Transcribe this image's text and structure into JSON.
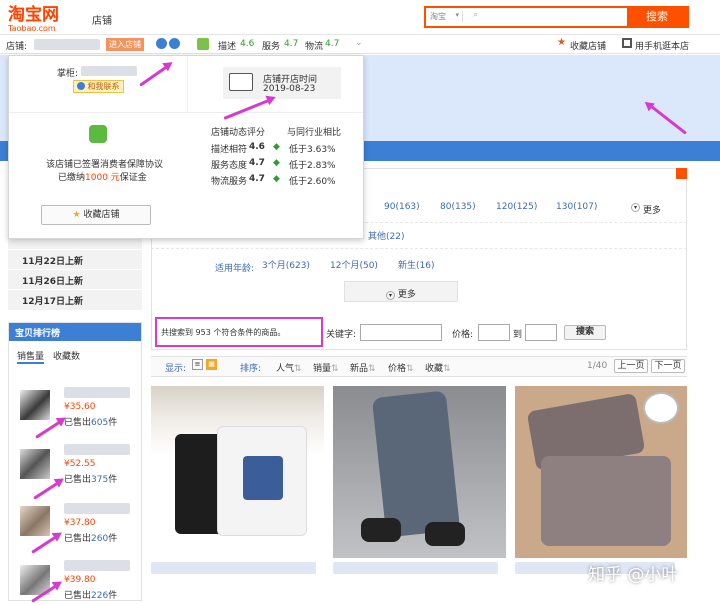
{
  "header": {
    "logo_cn": "淘宝网",
    "logo_en": "Taobao.com",
    "nav_label": "店铺",
    "search_scope": "淘宝",
    "search_button": "搜索"
  },
  "shopbar": {
    "shop_label": "店铺:",
    "enter_shop": "进入店铺",
    "desc_label": "描述",
    "desc_score": "4.6",
    "service_label": "服务",
    "service_score": "4.7",
    "logistics_label": "物流",
    "logistics_score": "4.7",
    "favorite": "收藏店铺",
    "mobile": "用手机逛本店"
  },
  "popup": {
    "keeper_label": "掌柜:",
    "contact": "和我联系",
    "open_time_label": "店铺开店时间",
    "open_time": "2019-08-23",
    "dynamic_label": "店铺动态评分",
    "compare_label": "与同行业相比",
    "ratings": [
      {
        "label": "描述相符",
        "score": "4.6",
        "compare": "低于3.63%"
      },
      {
        "label": "服务态度",
        "score": "4.7",
        "compare": "低于2.83%"
      },
      {
        "label": "物流服务",
        "score": "4.7",
        "compare": "低于2.60%"
      }
    ],
    "guarantee_line1": "该店铺已签署消费者保障协议",
    "guarantee_line2_prefix": "已缴纳",
    "guarantee_amount": "1000 元",
    "guarantee_line2_suffix": "保证金",
    "fav_button": "收藏店铺"
  },
  "left": {
    "new_items": [
      "11月22日上新",
      "11月26日上新",
      "12月17日上新"
    ],
    "rank_title": "宝贝排行榜",
    "tab_sales": "销售量",
    "tab_fav": "收藏数",
    "sold_prefix": "已售出",
    "unit": "件",
    "ranking": [
      {
        "price": "¥35.60",
        "sold": "605"
      },
      {
        "price": "¥52.55",
        "sold": "375"
      },
      {
        "price": "¥37.80",
        "sold": "260"
      },
      {
        "price": "¥39.80",
        "sold": "226"
      }
    ]
  },
  "filter": {
    "size_options": [
      "90(163)",
      "80(135)",
      "120(125)",
      "130(107)"
    ],
    "more": "更多",
    "other": "其他(22)",
    "age_label": "适用年龄:",
    "age_options": [
      "3个月(623)",
      "12个月(50)",
      "新生(16)"
    ],
    "more_center": "更多",
    "result_text": "共搜索到 953 个符合条件的商品。",
    "keyword_label": "关键字:",
    "price_label": "价格:",
    "to": "到",
    "search_btn": "搜索"
  },
  "sortbar": {
    "display": "显示:",
    "sort": "排序:",
    "options": [
      "人气",
      "销量",
      "新品",
      "价格",
      "收藏"
    ],
    "page": "1/40",
    "prev": "上一页",
    "next": "下一页"
  },
  "watermark": "知乎 @小叶",
  "colors": {
    "brand": "#ff5000",
    "accent_blue": "#3d7fd4",
    "arrow": "#d63ad1"
  }
}
